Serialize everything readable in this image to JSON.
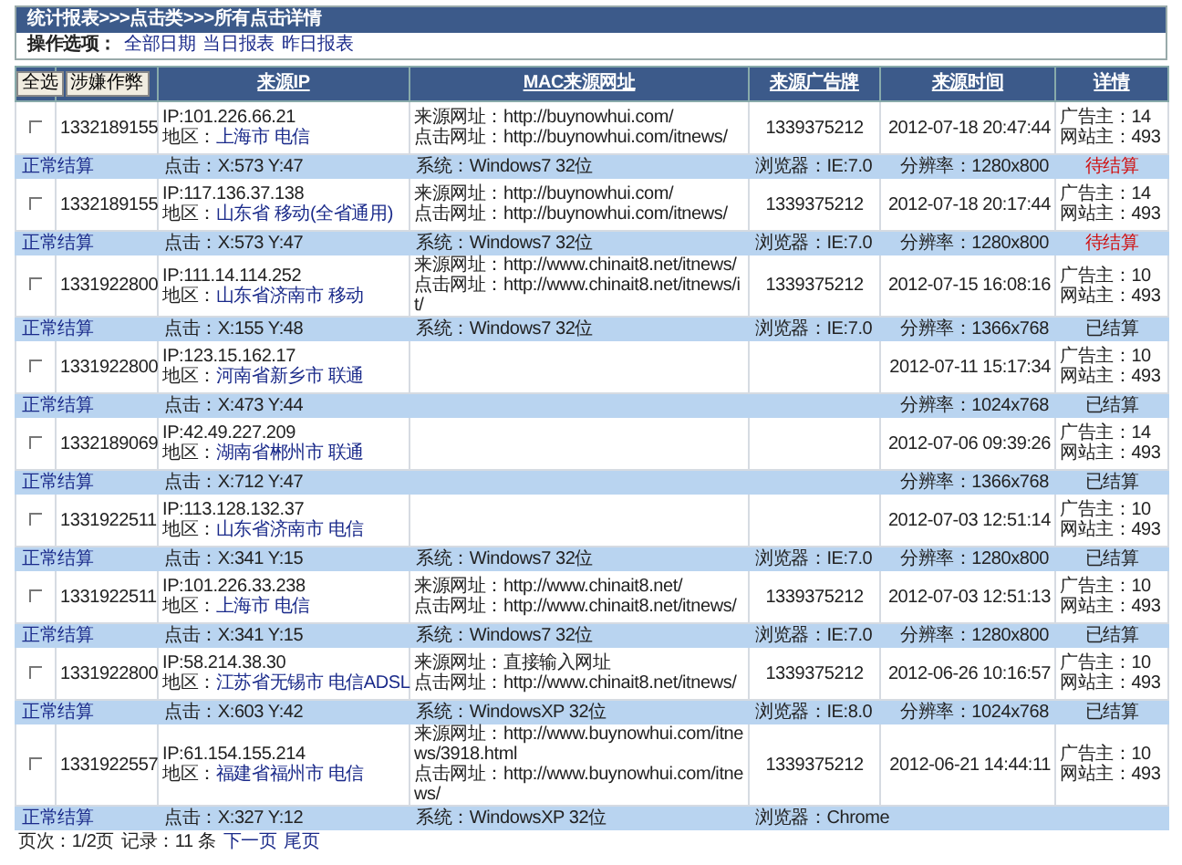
{
  "breadcrumb": "统计报表>>>点击类>>>所有点击详情",
  "options": {
    "label": "操作选项：",
    "links": [
      "全部日期",
      "当日报表",
      "昨日报表"
    ]
  },
  "table": {
    "columns": [
      {
        "label": "全选",
        "kind": "button"
      },
      {
        "label": "涉嫌作弊",
        "kind": "button"
      },
      {
        "label": "来源IP",
        "kind": "link"
      },
      {
        "label": "MAC来源网址",
        "kind": "link"
      },
      {
        "label": "来源广告牌",
        "kind": "link"
      },
      {
        "label": "来源时间",
        "kind": "link"
      },
      {
        "label": "详情",
        "kind": "link"
      }
    ],
    "rows": [
      {
        "checked": false,
        "id": "1332189155",
        "ip": "IP:101.226.66.21",
        "region_label": "地区：",
        "province": "上海市",
        "isp": "电信",
        "source_url": "来源网址：http://buynowhui.com/",
        "click_url": "点击网址：http://buynowhui.com/itnews/",
        "ad": "1339375212",
        "time": "2012-07-18 20:47:44",
        "advertiser": "广告主：14",
        "site": "网站主：493",
        "settle": "正常结算",
        "click": "点击：X:573 Y:47",
        "system": "系统：Windows7 32位",
        "browser": "浏览器：IE:7.0",
        "resolution": "分辨率：1280x800",
        "status": {
          "text": "待结算",
          "kind": "pending"
        }
      },
      {
        "checked": false,
        "id": "1332189155",
        "ip": "IP:117.136.37.138",
        "region_label": "地区：",
        "province": "山东省",
        "isp": "移动(全省通用)",
        "source_url": "来源网址：http://buynowhui.com/",
        "click_url": "点击网址：http://buynowhui.com/itnews/",
        "ad": "1339375212",
        "time": "2012-07-18 20:17:44",
        "advertiser": "广告主：14",
        "site": "网站主：493",
        "settle": "正常结算",
        "click": "点击：X:573 Y:47",
        "system": "系统：Windows7 32位",
        "browser": "浏览器：IE:7.0",
        "resolution": "分辨率：1280x800",
        "status": {
          "text": "待结算",
          "kind": "pending"
        }
      },
      {
        "checked": false,
        "id": "1331922800",
        "ip": "IP:111.14.114.252",
        "region_label": "地区：",
        "province": "山东省济南市",
        "isp": "移动",
        "source_url": "来源网址：http://www.chinait8.net/itnews/",
        "click_url": "点击网址：http://www.chinait8.net/itnews/it/",
        "ad": "1339375212",
        "time": "2012-07-15 16:08:16",
        "advertiser": "广告主：10",
        "site": "网站主：493",
        "settle": "正常结算",
        "click": "点击：X:155 Y:48",
        "system": "系统：Windows7 32位",
        "browser": "浏览器：IE:7.0",
        "resolution": "分辨率：1366x768",
        "status": {
          "text": "已结算",
          "kind": "settled"
        }
      },
      {
        "checked": false,
        "id": "1331922800",
        "ip": "IP:123.15.162.17",
        "region_label": "地区：",
        "province": "河南省新乡市",
        "isp": "联通",
        "time": "2012-07-11 15:17:34",
        "advertiser": "广告主：10",
        "site": "网站主：493",
        "settle": "正常结算",
        "click": "点击：X:473 Y:44",
        "resolution": "分辨率：1024x768",
        "status": {
          "text": "已结算",
          "kind": "settled"
        }
      },
      {
        "checked": false,
        "id": "1332189069",
        "ip": "IP:42.49.227.209",
        "region_label": "地区：",
        "province": "湖南省郴州市",
        "isp": "联通",
        "time": "2012-07-06 09:39:26",
        "advertiser": "广告主：14",
        "site": "网站主：493",
        "settle": "正常结算",
        "click": "点击：X:712 Y:47",
        "resolution": "分辨率：1366x768",
        "status": {
          "text": "已结算",
          "kind": "settled"
        }
      },
      {
        "checked": false,
        "id": "1331922511",
        "ip": "IP:113.128.132.37",
        "region_label": "地区：",
        "province": "山东省济南市",
        "isp": "电信",
        "time": "2012-07-03 12:51:14",
        "advertiser": "广告主：10",
        "site": "网站主：493",
        "settle": "正常结算",
        "click": "点击：X:341 Y:15",
        "system": "系统：Windows7 32位",
        "browser": "浏览器：IE:7.0",
        "resolution": "分辨率：1280x800",
        "status": {
          "text": "已结算",
          "kind": "settled"
        }
      },
      {
        "checked": false,
        "id": "1331922511",
        "ip": "IP:101.226.33.238",
        "region_label": "地区：",
        "province": "上海市",
        "isp": "电信",
        "source_url": "来源网址：http://www.chinait8.net/",
        "click_url": "点击网址：http://www.chinait8.net/itnews/",
        "ad": "1339375212",
        "time": "2012-07-03 12:51:13",
        "advertiser": "广告主：10",
        "site": "网站主：493",
        "settle": "正常结算",
        "click": "点击：X:341 Y:15",
        "system": "系统：Windows7 32位",
        "browser": "浏览器：IE:7.0",
        "resolution": "分辨率：1280x800",
        "status": {
          "text": "已结算",
          "kind": "settled"
        }
      },
      {
        "checked": false,
        "id": "1331922800",
        "ip": "IP:58.214.38.30",
        "region_label": "地区：",
        "province": "江苏省无锡市",
        "isp": "电信ADSL",
        "source_url": "来源网址：直接输入网址",
        "click_url": "点击网址：http://www.chinait8.net/itnews/",
        "ad": "1339375212",
        "time": "2012-06-26 10:16:57",
        "advertiser": "广告主：10",
        "site": "网站主：493",
        "settle": "正常结算",
        "click": "点击：X:603 Y:42",
        "system": "系统：WindowsXP 32位",
        "browser": "浏览器：IE:8.0",
        "resolution": "分辨率：1024x768",
        "status": {
          "text": "已结算",
          "kind": "settled"
        }
      },
      {
        "checked": false,
        "id": "1331922557",
        "ip": "IP:61.154.155.214",
        "region_label": "地区：",
        "province": "福建省福州市",
        "isp": "电信",
        "source_url": "来源网址：http://www.buynowhui.com/itnews/3918.html",
        "click_url": "点击网址：http://www.buynowhui.com/itnews/",
        "ad": "1339375212",
        "time": "2012-06-21 14:44:11",
        "advertiser": "广告主：10",
        "site": "网站主：493",
        "settle": "正常结算",
        "click": "点击：X:327 Y:12",
        "system": "系统：WindowsXP 32位",
        "browser": "浏览器：Chrome"
      }
    ]
  },
  "pager": {
    "page": "页次：1/2页",
    "records": "记录：11 条",
    "links": [
      "下一页",
      "尾页"
    ]
  }
}
